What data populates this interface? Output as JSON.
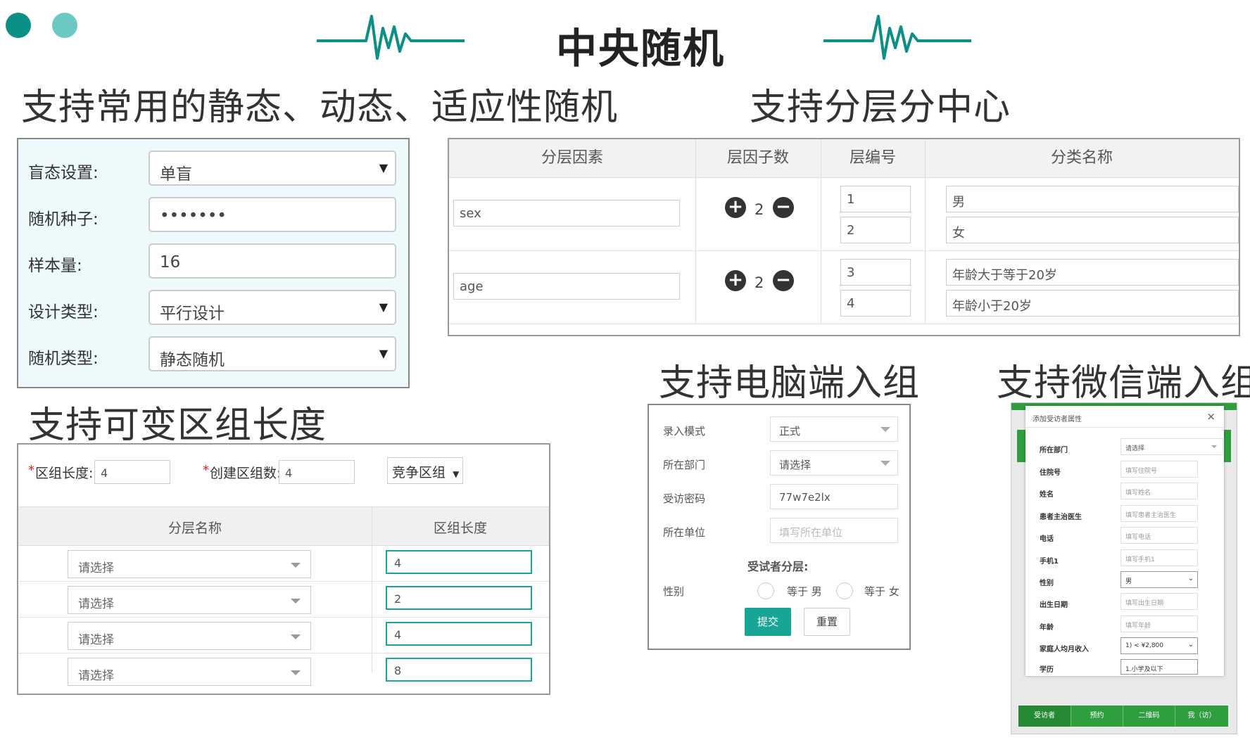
{
  "colors": {
    "accent": "#0b8f86",
    "accent_light": "#5fc3bb",
    "teal_button": "#17a596",
    "green_bar": "#2e9e3e"
  },
  "page_title": "中央随机",
  "headings": {
    "static_dynamic": "支持常用的静态、动态、适应性随机",
    "stratified": "支持分层分中心",
    "variable_block": "支持可变区组长度",
    "pc_enroll": "支持电脑端入组",
    "wechat_enroll": "支持微信端入组"
  },
  "settings_form": {
    "rows": [
      {
        "label": "盲态设置:",
        "value": "单盲",
        "dropdown": true
      },
      {
        "label": "随机种子:",
        "value": "•••••••",
        "dropdown": false
      },
      {
        "label": "样本量:",
        "value": "16",
        "dropdown": false
      },
      {
        "label": "设计类型:",
        "value": "平行设计",
        "dropdown": true
      },
      {
        "label": "随机类型:",
        "value": "静态随机",
        "dropdown": true
      }
    ],
    "caret": "▼"
  },
  "strata_table": {
    "headers": [
      "分层因素",
      "层因子数",
      "层编号",
      "分类名称"
    ],
    "rows": [
      {
        "factor": "sex",
        "count": "2",
        "codes": [
          "1",
          "2"
        ],
        "names": [
          "男",
          "女"
        ]
      },
      {
        "factor": "age",
        "count": "2",
        "codes": [
          "3",
          "4"
        ],
        "names": [
          "年龄大于等于20岁",
          "年龄小于20岁"
        ]
      }
    ],
    "plus": "+",
    "minus": "−"
  },
  "block_form": {
    "required_mark": "*",
    "block_length_label": "区组长度:",
    "block_length_value": "4",
    "block_count_label": "创建区组数:",
    "block_count_value": "4",
    "block_type": "竞争区组",
    "caret": "▼",
    "headers": [
      "分层名称",
      "区组长度"
    ],
    "rows": [
      {
        "layer": "请选择",
        "length": "4"
      },
      {
        "layer": "请选择",
        "length": "2"
      },
      {
        "layer": "请选择",
        "length": "4"
      },
      {
        "layer": "请选择",
        "length": "8"
      }
    ]
  },
  "pc_form": {
    "fields": [
      {
        "label": "录入模式",
        "value": "正式",
        "dropdown": true,
        "placeholder": false
      },
      {
        "label": "所在部门",
        "value": "请选择",
        "dropdown": true,
        "placeholder": false
      },
      {
        "label": "受访密码",
        "value": "77w7e2lx",
        "dropdown": false,
        "placeholder": false
      },
      {
        "label": "所在单位",
        "value": "填写所在单位",
        "dropdown": false,
        "placeholder": true
      }
    ],
    "strata_title": "受试者分层:",
    "gender_label": "性别",
    "radio_options": [
      "等于 男",
      "等于 女"
    ],
    "submit": "提交",
    "reset": "重置"
  },
  "wechat": {
    "modal_title": "添加受访者属性",
    "close": "×",
    "fields": [
      {
        "label": "所在部门",
        "value": "请选择",
        "kind": "dropdown"
      },
      {
        "label": "住院号",
        "value": "填写住院号",
        "kind": "text"
      },
      {
        "label": "姓名",
        "value": "填写姓名",
        "kind": "text"
      },
      {
        "label": "患者主治医生",
        "value": "填写患者主治医生",
        "kind": "text"
      },
      {
        "label": "电话",
        "value": "填写电话",
        "kind": "text"
      },
      {
        "label": "手机1",
        "value": "填写手机1",
        "kind": "text"
      },
      {
        "label": "性别",
        "value": "男",
        "kind": "select"
      },
      {
        "label": "出生日期",
        "value": "填写出生日期",
        "kind": "text"
      },
      {
        "label": "年龄",
        "value": "填写年龄",
        "kind": "text"
      },
      {
        "label": "家庭人均月收入",
        "value": "1) < ¥2,800",
        "kind": "select"
      },
      {
        "label": "学历",
        "value": "1.小学及以下",
        "kind": "select"
      }
    ],
    "tabs": [
      "受访者",
      "预约",
      "二维码",
      "我（访）"
    ]
  }
}
